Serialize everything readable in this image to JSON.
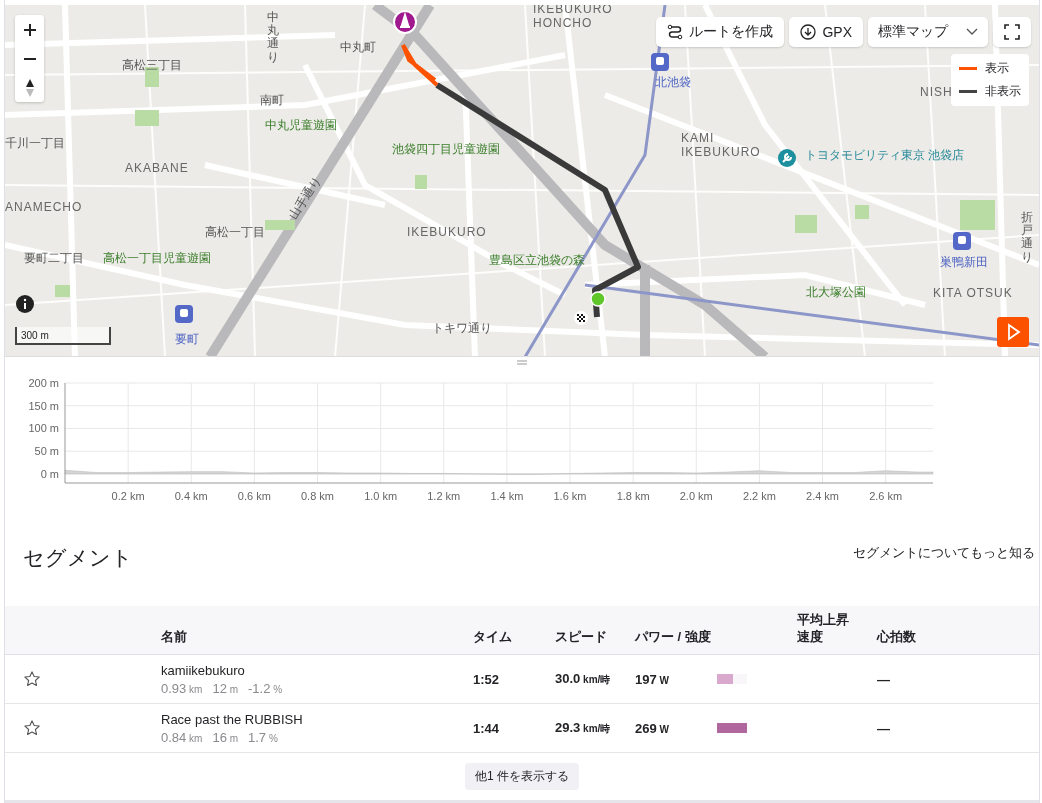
{
  "map": {
    "controls": {
      "route_button": "ルートを作成",
      "gpx_button": "GPX",
      "map_style": "標準マップ"
    },
    "legend": [
      {
        "label": "表示",
        "color": "#fc5200"
      },
      {
        "label": "非表示",
        "color": "#444444"
      }
    ],
    "labels": [
      {
        "text": "中丸町",
        "kind": "place"
      },
      {
        "text": "高松三丁目",
        "kind": "place"
      },
      {
        "text": "南町",
        "kind": "place"
      },
      {
        "text": "中丸児童遊園",
        "kind": "park"
      },
      {
        "text": "池袋四丁目児童遊園",
        "kind": "park"
      },
      {
        "text": "千川一丁目",
        "kind": "place"
      },
      {
        "text": "AKABANE",
        "kind": "district"
      },
      {
        "text": "ANAMECHO",
        "kind": "district"
      },
      {
        "text": "高松一丁目",
        "kind": "place"
      },
      {
        "text": "要町二丁目",
        "kind": "place"
      },
      {
        "text": "高松一丁目児童遊園",
        "kind": "park"
      },
      {
        "text": "IKEBUKURO",
        "kind": "district"
      },
      {
        "text": "豊島区立池袋の森",
        "kind": "park"
      },
      {
        "text": "トキワ通り",
        "kind": "place"
      },
      {
        "text": "要町",
        "kind": "station"
      },
      {
        "text": "山手通り",
        "kind": "road"
      },
      {
        "text": "中丸通り",
        "kind": "road-vertical"
      },
      {
        "text": "IKEBUKURO HONCHO",
        "kind": "district"
      },
      {
        "text": "北池袋",
        "kind": "station"
      },
      {
        "text": "KAMI IKEBUKURO",
        "kind": "district"
      },
      {
        "text": "トヨタモビリティ東京 池袋店",
        "kind": "shop"
      },
      {
        "text": "NISH",
        "kind": "district"
      },
      {
        "text": "巣鴨新田",
        "kind": "station"
      },
      {
        "text": "北大塚公園",
        "kind": "park"
      },
      {
        "text": "KITA OTSUK",
        "kind": "district"
      },
      {
        "text": "折戸通り",
        "kind": "road-vertical"
      }
    ],
    "scale": "300 m"
  },
  "elevation": {
    "chart_data": {
      "type": "area",
      "x": [
        0,
        0.1,
        0.2,
        0.3,
        0.4,
        0.5,
        0.6,
        0.7,
        0.8,
        0.9,
        1.0,
        1.1,
        1.2,
        1.3,
        1.4,
        1.5,
        1.6,
        1.7,
        1.8,
        1.9,
        2.0,
        2.1,
        2.2,
        2.3,
        2.4,
        2.5,
        2.6,
        2.7,
        2.75
      ],
      "grid": true,
      "series": [
        {
          "color": "#d4d4d4",
          "values": [
            8,
            3,
            3,
            4,
            5,
            5,
            2,
            3,
            3,
            2,
            2,
            1,
            1,
            0,
            -1,
            -1,
            1,
            2,
            3,
            3,
            2,
            4,
            7,
            3,
            3,
            3,
            7,
            4,
            4
          ]
        }
      ],
      "xlim": [
        0,
        2.75
      ],
      "ylim": [
        -20,
        200
      ],
      "xticks": [
        {
          "value": 0.2,
          "label": "0.2 km"
        },
        {
          "value": 0.4,
          "label": "0.4 km"
        },
        {
          "value": 0.6,
          "label": "0.6 km"
        },
        {
          "value": 0.8,
          "label": "0.8 km"
        },
        {
          "value": 1.0,
          "label": "1.0 km"
        },
        {
          "value": 1.2,
          "label": "1.2 km"
        },
        {
          "value": 1.4,
          "label": "1.4 km"
        },
        {
          "value": 1.6,
          "label": "1.6 km"
        },
        {
          "value": 1.8,
          "label": "1.8 km"
        },
        {
          "value": 2.0,
          "label": "2.0 km"
        },
        {
          "value": 2.2,
          "label": "2.2 km"
        },
        {
          "value": 2.4,
          "label": "2.4 km"
        },
        {
          "value": 2.6,
          "label": "2.6 km"
        }
      ],
      "yticks": [
        {
          "value": 0,
          "label": "0 m"
        },
        {
          "value": 50,
          "label": "50 m"
        },
        {
          "value": 100,
          "label": "100 m"
        },
        {
          "value": 150,
          "label": "150 m"
        },
        {
          "value": 200,
          "label": "200 m"
        }
      ]
    }
  },
  "segments": {
    "title": "セグメント",
    "learn_more": "セグメントについてもっと知る",
    "columns": [
      "名前",
      "タイム",
      "スピード",
      "パワー / 強度",
      "平均上昇速度",
      "心拍数"
    ],
    "rows": [
      {
        "name": "kamiikebukuro",
        "stats": [
          {
            "value": "0.93",
            "unit": "km"
          },
          {
            "value": "12",
            "unit": "m"
          },
          {
            "value": "-1.2",
            "unit": "%"
          }
        ],
        "time": "1:52",
        "speed": "30.0",
        "speed_unit": "km/時",
        "power": "197",
        "power_unit": "W",
        "intensity": {
          "level": 0.53,
          "color": "#d8a9cc"
        },
        "heart_rate": "—"
      },
      {
        "name": "Race past the RUBBISH",
        "stats": [
          {
            "value": "0.84",
            "unit": "km"
          },
          {
            "value": "16",
            "unit": "m"
          },
          {
            "value": "1.7",
            "unit": "%"
          }
        ],
        "time": "1:44",
        "speed": "29.3",
        "speed_unit": "km/時",
        "power": "269",
        "power_unit": "W",
        "intensity": {
          "level": 1,
          "color": "#b0679e"
        },
        "heart_rate": "—"
      }
    ],
    "show_more": "他1 件を表示する"
  }
}
